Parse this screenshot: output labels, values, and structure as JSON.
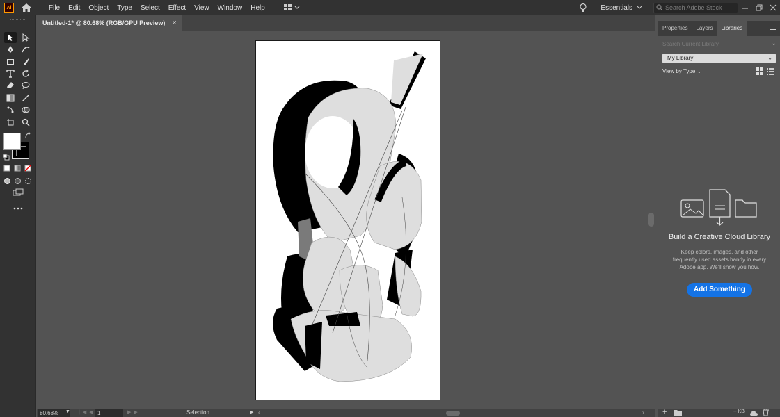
{
  "app": {
    "logo": "Ai"
  },
  "menu": {
    "items": [
      "File",
      "Edit",
      "Object",
      "Type",
      "Select",
      "Effect",
      "View",
      "Window",
      "Help"
    ],
    "workspace": "Essentials",
    "stock_search_placeholder": "Search Adobe Stock"
  },
  "document": {
    "tab_title": "Untitled-1* @ 80.68% (RGB/GPU Preview)",
    "close_glyph": "×"
  },
  "statusbar": {
    "zoom": "80.68%",
    "artboard_number": "1",
    "mode": "Selection"
  },
  "panel": {
    "tabs": [
      "Properties",
      "Layers",
      "Libraries"
    ],
    "active_tab": "Libraries",
    "search_placeholder": "Search Current Library",
    "library_selected": "My Library",
    "view_by": "View by Type",
    "empty_title": "Build a Creative Cloud Library",
    "empty_description": "Keep colors, images, and other frequently used assets handy in every Adobe app. We'll show you how.",
    "add_button": "Add Something",
    "footer_size": "-- KB"
  },
  "colors": {
    "accent": "#1473e6",
    "chrome_dark": "#323232",
    "canvas": "#535353",
    "logo_orange": "#ff9a00"
  },
  "icons": {
    "menubar": [
      "home-icon",
      "arrange-documents-icon",
      "lightbulb-icon",
      "search-icon",
      "minimize-icon",
      "restore-icon",
      "close-icon"
    ],
    "tools": [
      "selection-tool-icon",
      "direct-selection-tool-icon",
      "pen-tool-icon",
      "curvature-tool-icon",
      "rectangle-tool-icon",
      "paintbrush-tool-icon",
      "type-tool-icon",
      "rotate-tool-icon",
      "eraser-tool-icon",
      "lasso-tool-icon",
      "gradient-tool-icon",
      "eyedropper-tool-icon",
      "puppet-warp-tool-icon",
      "shape-builder-tool-icon",
      "artboard-tool-icon",
      "zoom-tool-icon"
    ]
  }
}
